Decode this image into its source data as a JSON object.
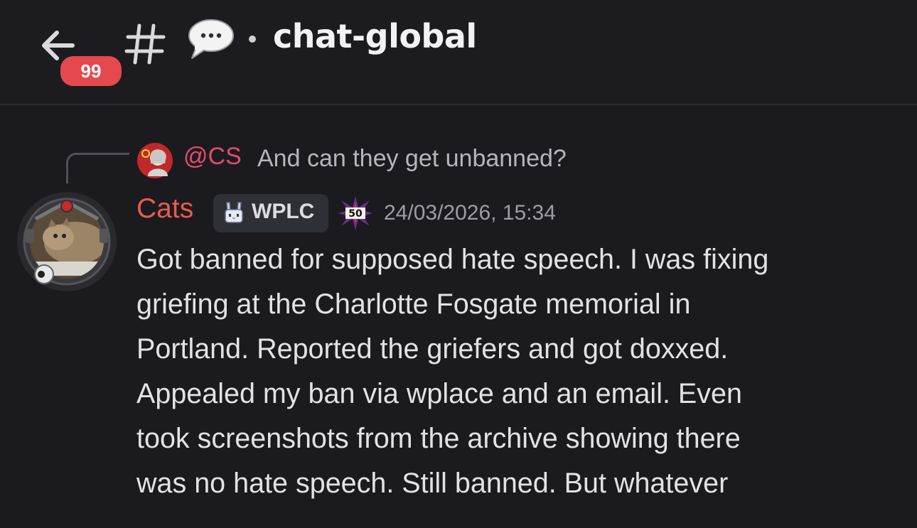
{
  "header": {
    "unread_count": "99",
    "channel_name": "chat-global",
    "icons": {
      "back": "arrow-left-icon",
      "channel": "hash-icon",
      "emoji": "speech-bubble-icon"
    }
  },
  "message": {
    "reply": {
      "mention": "@CS",
      "text": "And can they get unbanned?"
    },
    "author": {
      "name": "Cats",
      "name_color": "#e85b4d",
      "tag": "WPLC",
      "tag_icon": "bunny-icon",
      "level_badge": "50"
    },
    "timestamp": "24/03/2026, 15:34",
    "lines": [
      "Got banned for supposed hate speech. I was fixing",
      "griefing at the Charlotte Fosgate memorial in",
      "Portland. Reported the griefers and got doxxed.",
      "Appealed my ban via wplace and an email. Even",
      "took screenshots from the archive showing there",
      "was no hate speech. Still banned. But whatever"
    ]
  },
  "colors": {
    "background": "#1b1b1f",
    "badge": "#e5484d",
    "mention": "#e24c6e"
  }
}
